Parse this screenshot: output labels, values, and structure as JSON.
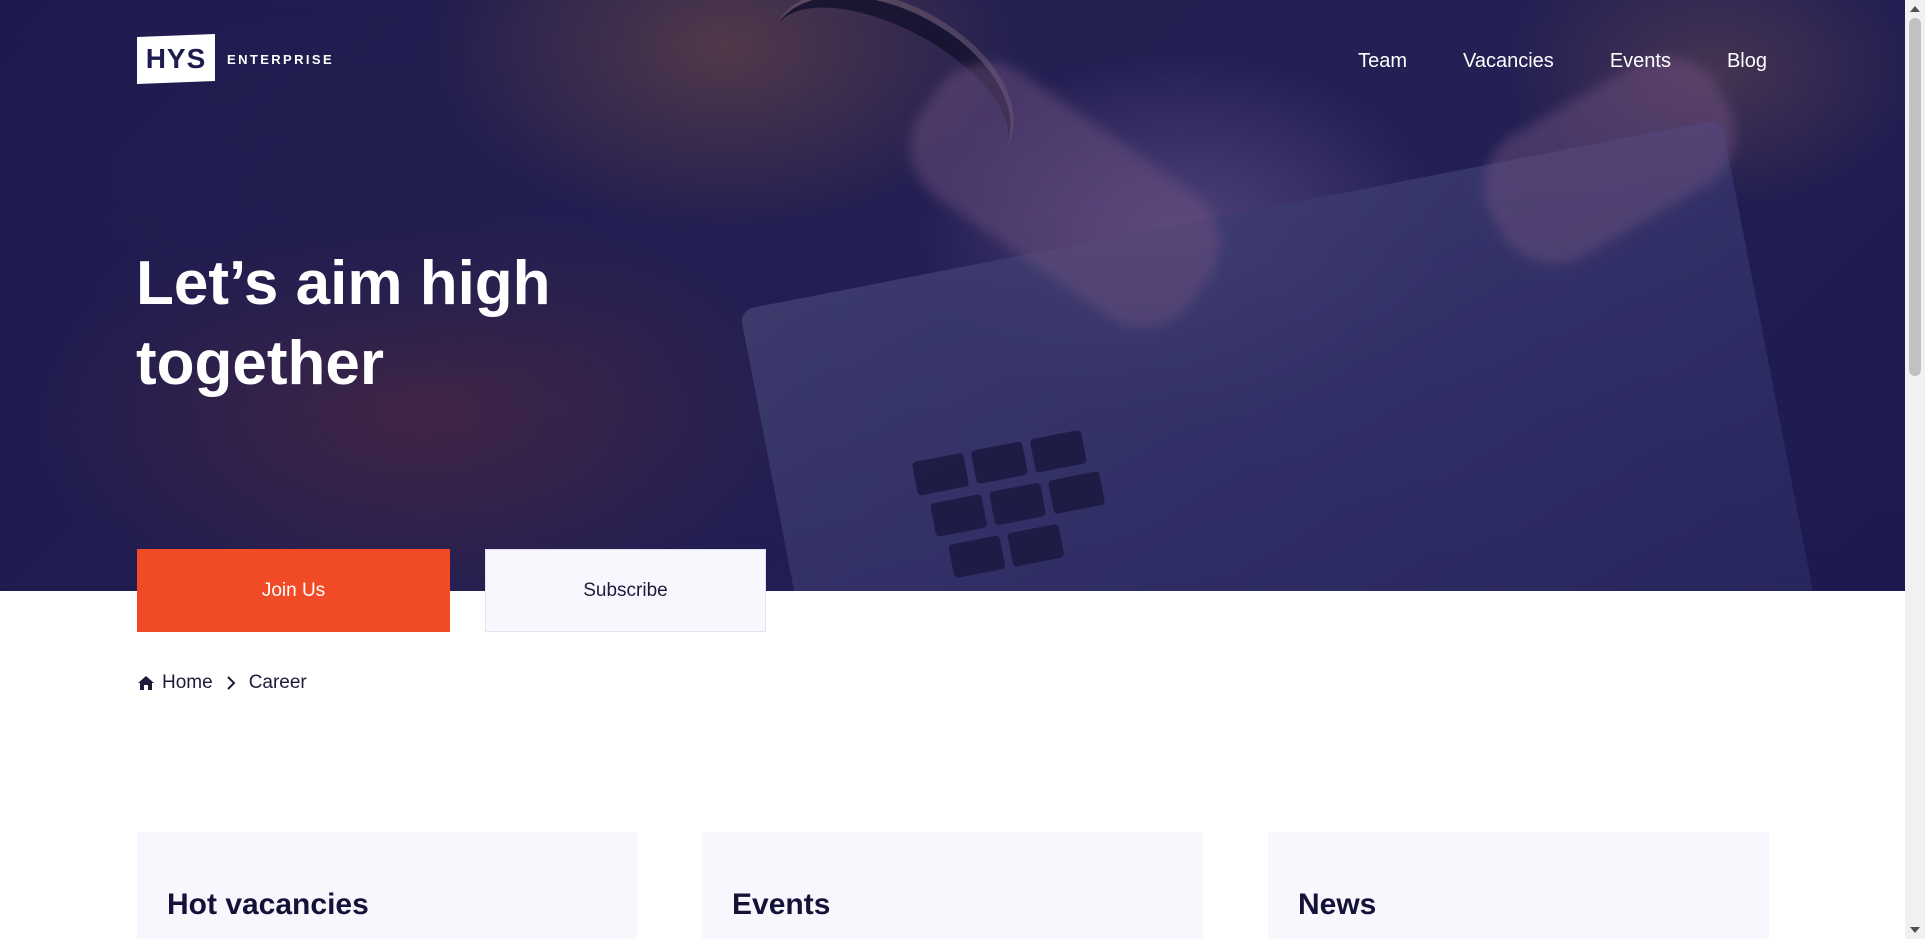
{
  "colors": {
    "hero_overlay": "#201c4c",
    "accent": "#f14a26",
    "card_bg": "#f8f7fd",
    "heading": "#141238",
    "text": "#1d1b3a"
  },
  "logo": {
    "mark": "HYS",
    "subtitle": "ENTERPRISE"
  },
  "nav": {
    "items": [
      {
        "label": "Team"
      },
      {
        "label": "Vacancies"
      },
      {
        "label": "Events"
      },
      {
        "label": "Blog"
      }
    ]
  },
  "hero": {
    "title": "Let’s aim high together"
  },
  "buttons": {
    "join_label": "Join Us",
    "subscribe_label": "Subscribe"
  },
  "breadcrumb": {
    "home_icon": "home-icon",
    "separator_icon": "chevron-right-icon",
    "home": "Home",
    "current": "Career"
  },
  "cards": [
    {
      "title": "Hot vacancies"
    },
    {
      "title": "Events"
    },
    {
      "title": "News"
    }
  ]
}
